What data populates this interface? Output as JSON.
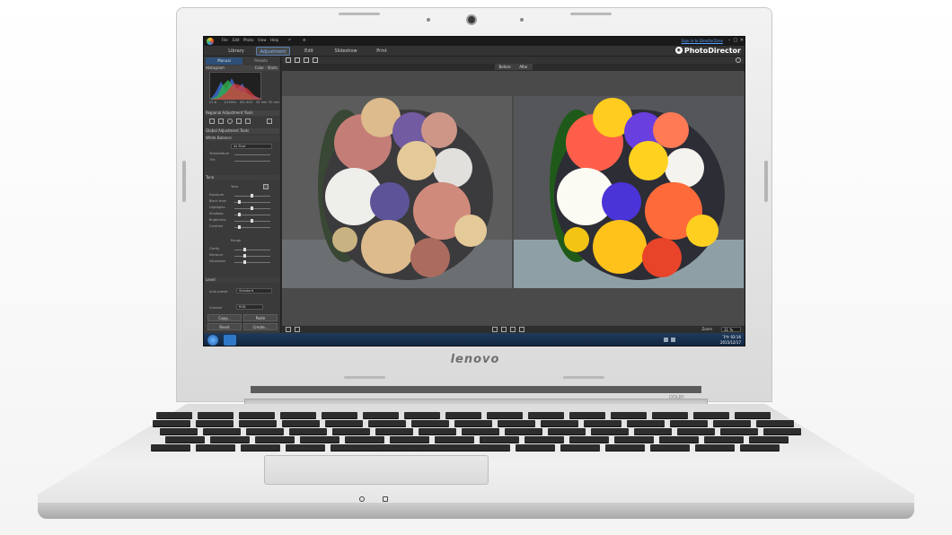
{
  "laptop": {
    "brand": "lenovo",
    "speaker_label": "DOLBY"
  },
  "app": {
    "menu": [
      "File",
      "Edit",
      "Photo",
      "View",
      "Help"
    ],
    "signin": "Sign in to DirectorZone",
    "product_name": "PhotoDirector",
    "window_buttons": [
      "–",
      "□",
      "✕"
    ],
    "nav_tabs": [
      {
        "label": "Library",
        "active": false
      },
      {
        "label": "Adjustment",
        "active": true
      },
      {
        "label": "Edit",
        "active": false
      },
      {
        "label": "Slideshow",
        "active": false
      },
      {
        "label": "Print",
        "active": false
      }
    ]
  },
  "left_panel": {
    "tabs": [
      "Manual",
      "Presets"
    ],
    "histogram_title": "Histogram",
    "histogram_meta": "Color · Shots",
    "histogram_values": [
      "f/1.6",
      "1/1000s",
      "ISO 400",
      "35 mm",
      "50 mm"
    ],
    "regional_title": "Regional Adjustment Tools",
    "global_title": "Global Adjustment Tools",
    "white_balance": {
      "title": "White Balance",
      "select": "As Shot",
      "rows": [
        "Temperature",
        "Tint"
      ]
    },
    "tone": {
      "title": "Tone",
      "tone_label": "Tone",
      "rows": [
        "Exposure",
        "Black level",
        "Highlights",
        "Shadows",
        "Brightness",
        "Contrast"
      ],
      "range_label": "Range",
      "range_rows": [
        "Clarity",
        "Vibrance",
        "Saturation"
      ]
    },
    "level": {
      "title": "Level",
      "select_label": "Auto preset",
      "select": "Standard"
    },
    "channel": {
      "label": "Channel",
      "select": "RGB"
    },
    "buttons": [
      "Copy...",
      "Paste",
      "Reset",
      "Create..."
    ]
  },
  "viewer": {
    "before_label": "Before",
    "after_label": "After",
    "zoom_label": "Zoom",
    "zoom_value": "31 %"
  },
  "taskbar": {
    "time": "下午 03:16",
    "date": "2015/12/17"
  },
  "colors": {
    "accent": "#5aa0ff",
    "active_tab": "#2e4f78",
    "screen_bg": "#2b2b2b",
    "taskbar": "#1f3a5c"
  }
}
